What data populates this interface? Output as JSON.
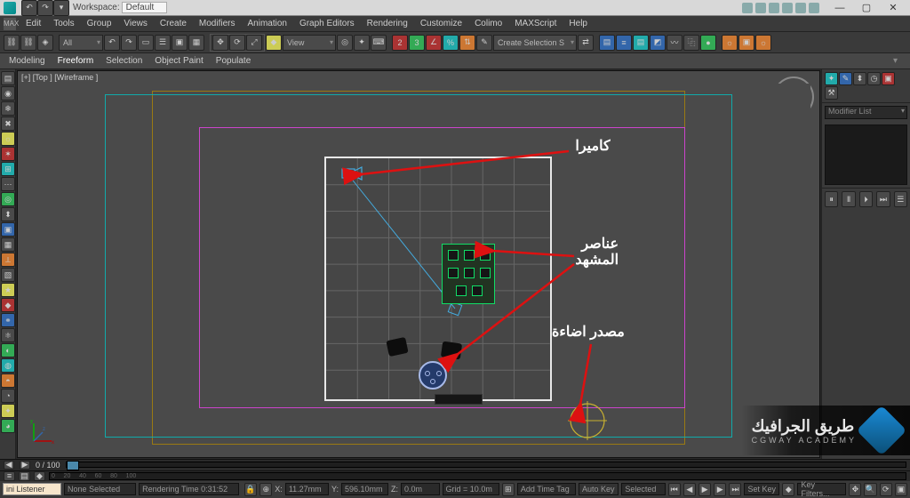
{
  "title": {
    "workspace_label": "Workspace:",
    "workspace_value": "Default"
  },
  "menu": [
    "Edit",
    "Tools",
    "Group",
    "Views",
    "Create",
    "Modifiers",
    "Animation",
    "Graph Editors",
    "Rendering",
    "Customize",
    "Colimo",
    "MAXScript",
    "Help"
  ],
  "mini": "MAX",
  "toolbar": {
    "view_dd": "View",
    "create_sel": "Create Selection S",
    "all_dd": "All"
  },
  "ribbon_tabs": [
    "Modeling",
    "Freeform",
    "Selection",
    "Object Paint",
    "Populate"
  ],
  "viewport_label": "[+] [Top ] [Wireframe ]",
  "rightpanel": {
    "modifier_list": "Modifier List"
  },
  "annotations": {
    "camera": "كاميرا",
    "elements": "عناصر\nالمشهد",
    "light": "مصدر اضاءة"
  },
  "overlay": {
    "ar": "طريق الجرافيك",
    "en": "CGWAY ACADEMY"
  },
  "bottom": {
    "frame": "0 / 100",
    "none_selected": "None Selected",
    "mini_listener": "ini Listener",
    "rendering_time": "Rendering Time  0:31:52",
    "x_label": "X:",
    "x_val": "11.27mm",
    "y_label": "Y:",
    "y_val": "596.10mm",
    "z_label": "Z:",
    "z_val": "0.0m",
    "grid": "Grid = 10.0m",
    "add_time_tag": "Add Time Tag",
    "autokey": "Auto Key",
    "setkey": "Set Key",
    "selected_dd": "Selected",
    "keyfilters": "Key Filters..."
  }
}
